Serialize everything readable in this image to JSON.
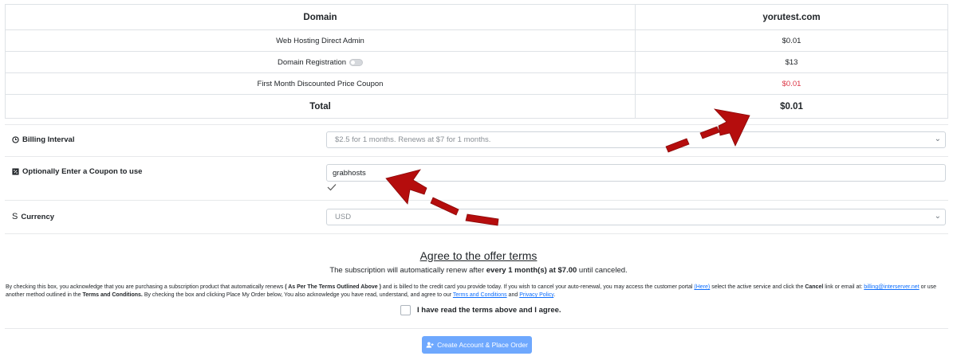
{
  "summary": {
    "header": {
      "left": "Domain",
      "right": "yorutest.com"
    },
    "items": [
      {
        "label": "Web Hosting Direct Admin",
        "price": "$0.01",
        "toggle": false,
        "discount": false
      },
      {
        "label": "Domain Registration",
        "price": "$13",
        "toggle": true,
        "discount": false
      },
      {
        "label": "First Month Discounted Price Coupon",
        "price": "$0.01",
        "toggle": false,
        "discount": true
      }
    ],
    "total": {
      "label": "Total",
      "value": "$0.01"
    }
  },
  "form": {
    "billing_interval": {
      "label": "Billing Interval",
      "icon": "clock-icon",
      "value": "$2.5 for 1 months. Renews at $7 for 1 months."
    },
    "coupon": {
      "label": "Optionally Enter a Coupon to use",
      "icon": "coupon-icon",
      "value": "grabhosts",
      "status_icon": "checkmark-icon"
    },
    "currency": {
      "label": "Currency",
      "icon": "dollar-icon",
      "value": "USD"
    }
  },
  "terms": {
    "title": "Agree to the offer terms",
    "sub_prefix": "The subscription will automatically renew after",
    "sub_bold": "every 1 month(s) at $7.00",
    "sub_suffix": "until canceled.",
    "body_1": "By checking this box, you acknowledge that you are purchasing a subscription product that automatically renews",
    "body_bold_1": "( As Per The Terms Outlined Above )",
    "body_2": "and is billed to the credit card you provide today. If you wish to cancel your auto-renewal, you may access the customer portal",
    "link_here": "(Here)",
    "body_3": "select the active service and click the",
    "body_bold_2": "Cancel",
    "body_4": "link or email at:",
    "link_email": "billing@interserver.net",
    "body_5": "or use another method outlined in the",
    "body_bold_3": "Terms and Conditions.",
    "body_6": "By checking the box and clicking Place My Order below, You also acknowledge you have read, understand, and agree to our",
    "link_terms": "Terms and Conditions",
    "body_7": "and",
    "link_privacy": "Privacy Policy",
    "body_8": ".",
    "agree_label": "I have read the terms above and I agree."
  },
  "button": {
    "label": "Create Account & Place Order",
    "icon": "user-plus-icon"
  },
  "colors": {
    "accent": "#6ea8fe",
    "discount": "#dc3545",
    "arrow": "#b50d0d",
    "link": "#0d6efd"
  }
}
